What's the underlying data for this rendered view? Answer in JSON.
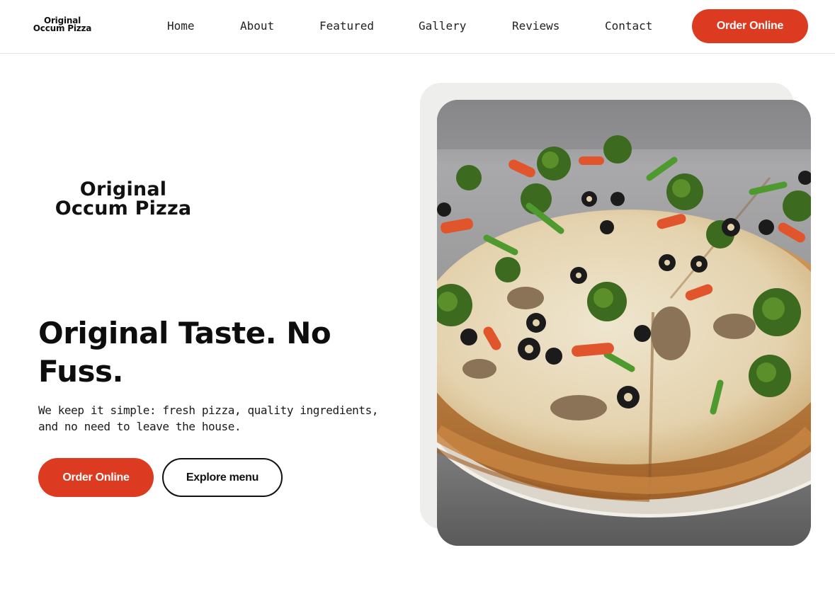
{
  "header": {
    "logo_line1": "Original",
    "logo_line2": "Occum Pizza",
    "nav": [
      "Home",
      "About",
      "Featured",
      "Gallery",
      "Reviews",
      "Contact"
    ],
    "cta_label": "Order Online"
  },
  "hero": {
    "logo_line1": "Original",
    "logo_line2": "Occum Pizza",
    "headline": "Original Taste. No Fuss.",
    "subtext": "We keep it simple: fresh pizza, quality ingredients, and no need to leave the house.",
    "primary_button": "Order Online",
    "secondary_button": "Explore menu"
  },
  "colors": {
    "accent": "#dc3b22",
    "text": "#111111",
    "card_background": "#eeeeec"
  }
}
